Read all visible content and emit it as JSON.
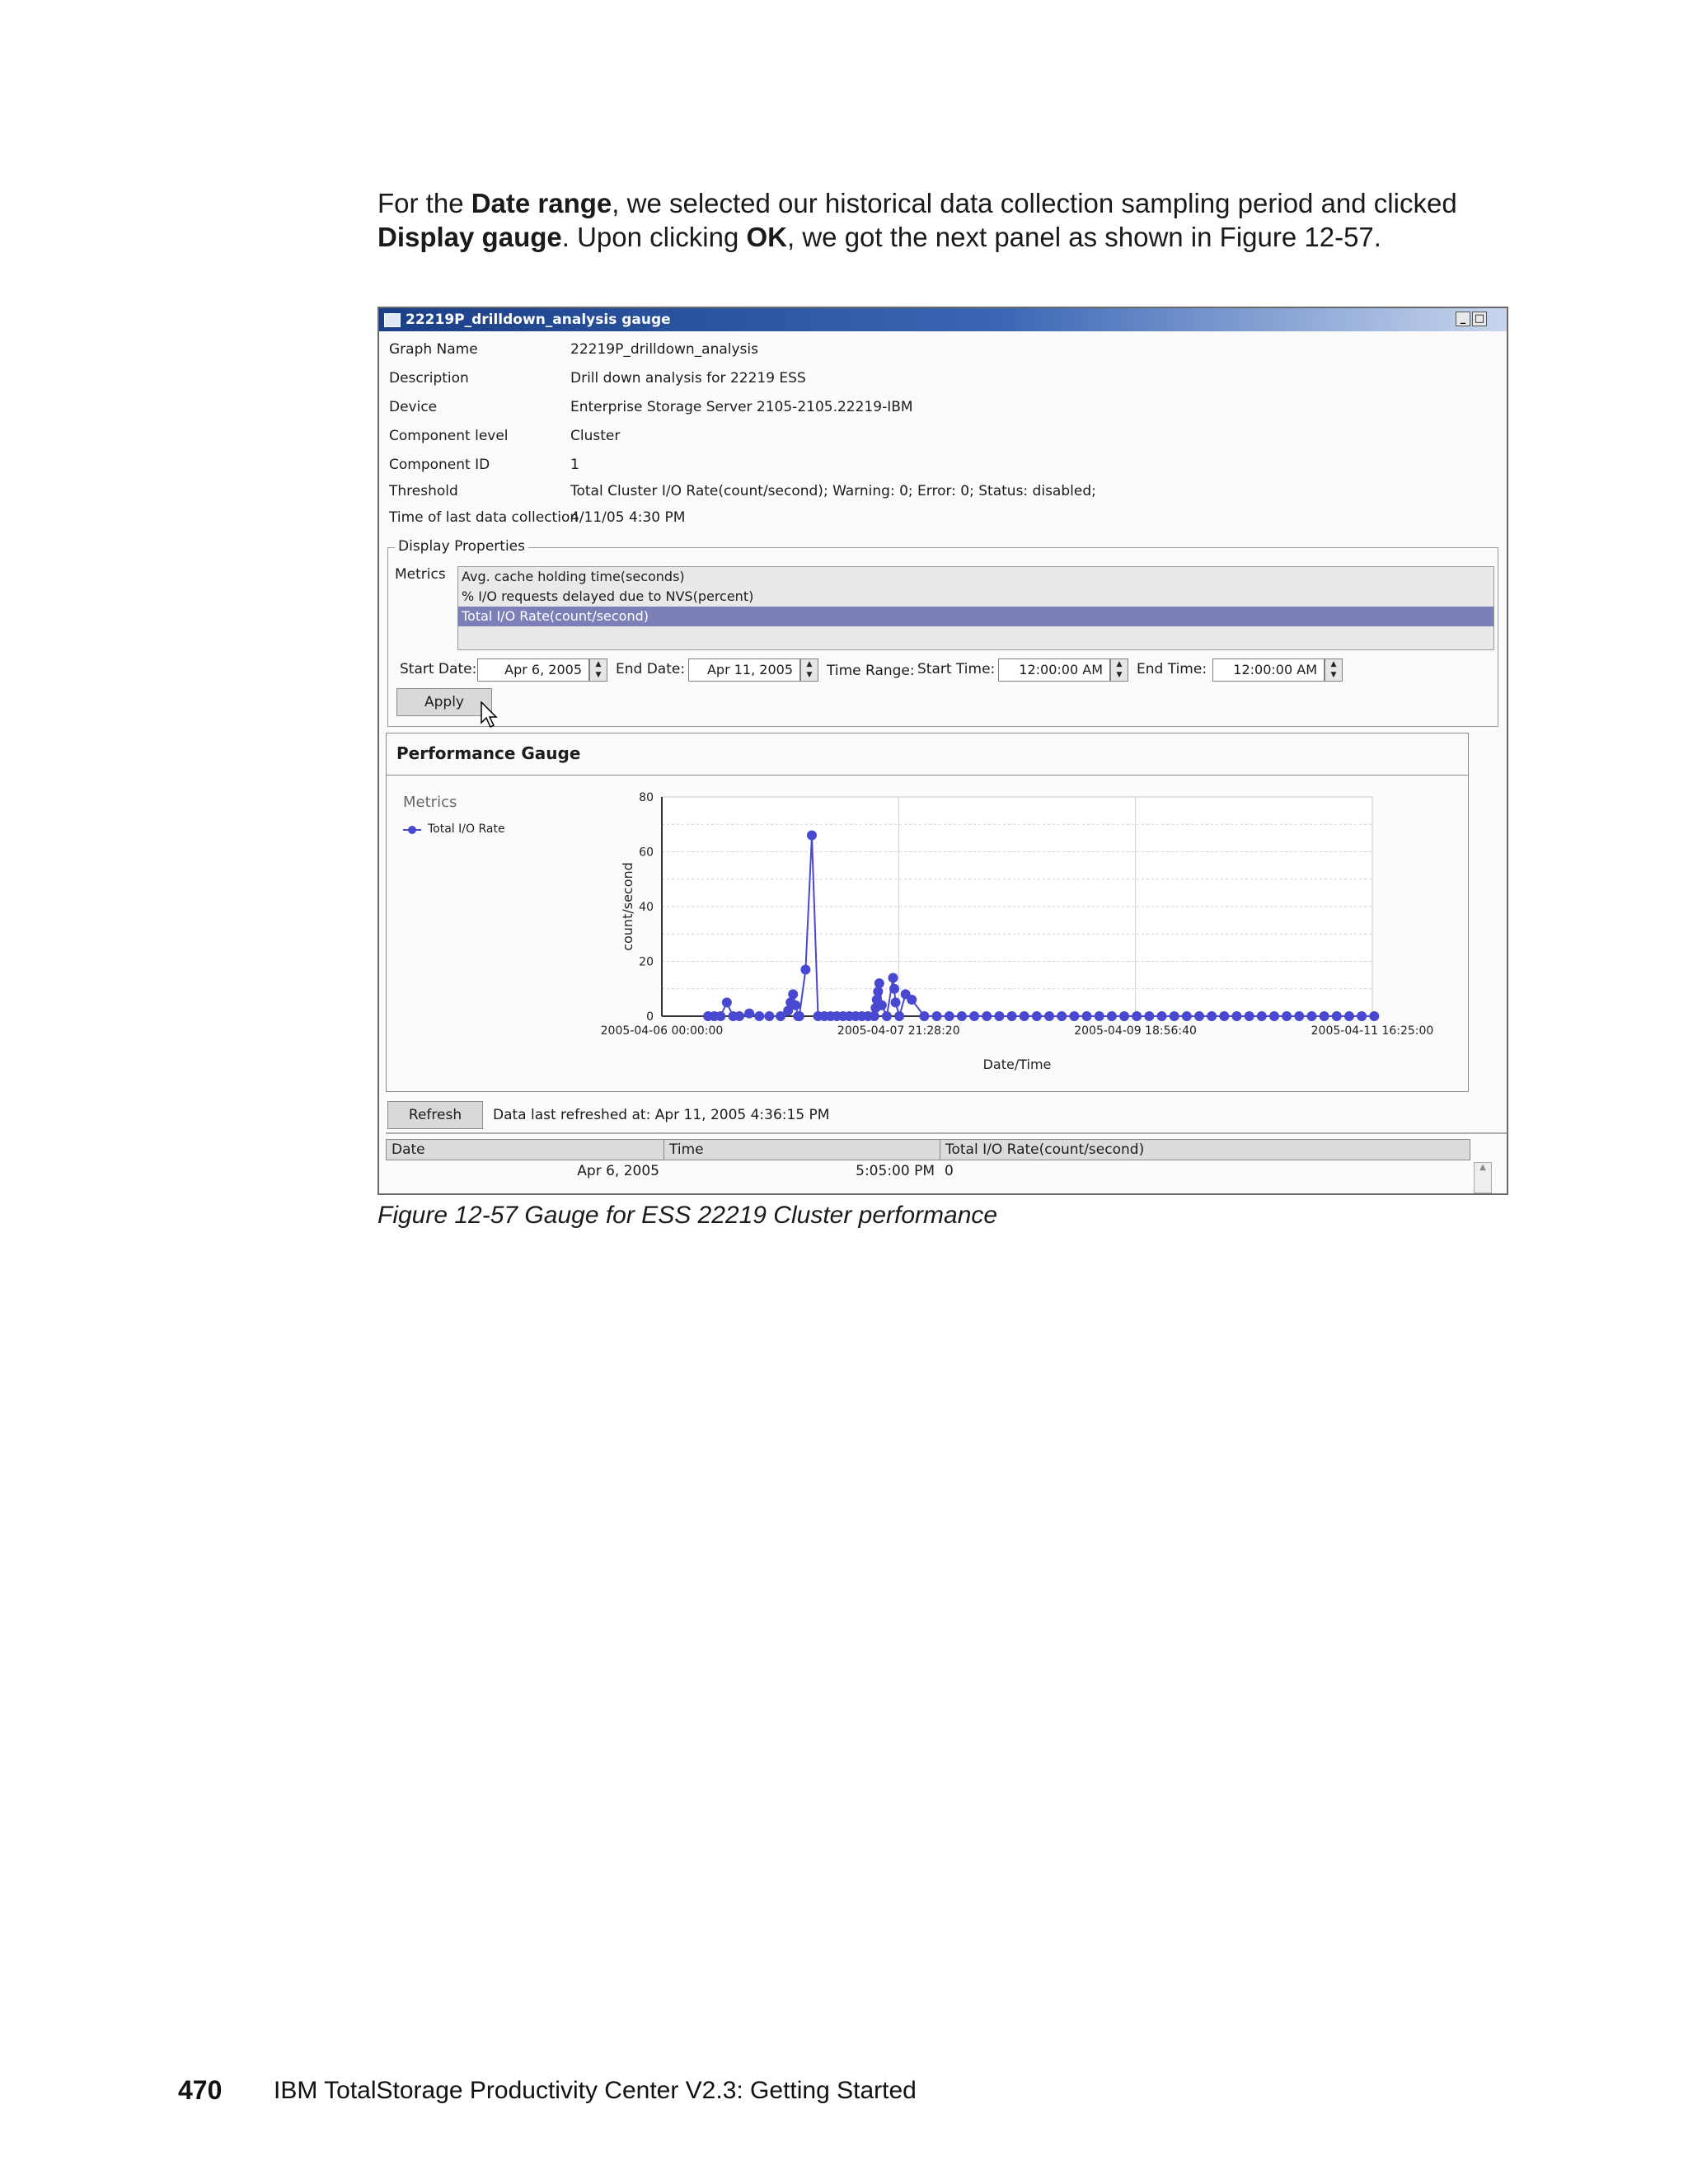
{
  "intro": {
    "p1": "For the ",
    "b1": "Date range",
    "p2": ", we selected our historical data collection sampling period and clicked ",
    "b2": "Display gauge",
    "p3": ". Upon clicking ",
    "b3": "OK",
    "p4": ", we got the next panel as shown in Figure 12-57."
  },
  "window": {
    "title": "22219P_drilldown_analysis gauge",
    "min_glyph": "_",
    "max_glyph": "□",
    "properties": [
      {
        "label": "Graph Name",
        "value": "22219P_drilldown_analysis"
      },
      {
        "label": "Description",
        "value": "Drill down analysis for 22219 ESS"
      },
      {
        "label": "Device",
        "value": "Enterprise Storage Server 2105-2105.22219-IBM"
      },
      {
        "label": "Component level",
        "value": "Cluster"
      },
      {
        "label": "Component ID",
        "value": "1"
      },
      {
        "label": "Threshold",
        "value": "Total Cluster I/O Rate(count/second); Warning: 0; Error: 0; Status: disabled;"
      },
      {
        "label": "Time of last data collection",
        "value": "4/11/05 4:30 PM"
      }
    ],
    "display_properties": {
      "legend": "Display Properties",
      "metrics_label": "Metrics",
      "metrics": [
        "Avg. cache holding time(seconds)",
        "% I/O requests delayed due to NVS(percent)",
        "Total I/O Rate(count/second)"
      ],
      "start_date_label": "Start Date:",
      "start_date": "Apr 6, 2005",
      "end_date_label": "End Date:",
      "end_date": "Apr 11, 2005",
      "time_range_label": "Time Range:",
      "start_time_label": "Start Time:",
      "start_time": "12:00:00 AM",
      "end_time_label": "End Time:",
      "end_time": "12:00:00 AM",
      "apply": "Apply"
    },
    "gauge": {
      "title": "Performance Gauge",
      "legend_title": "Metrics",
      "legend_item": "Total I/O Rate"
    },
    "refresh": "Refresh",
    "refreshed_text": "Data last refreshed at: Apr 11, 2005 4:36:15 PM",
    "table": {
      "headers": [
        "Date",
        "Time",
        "Total I/O Rate(count/second)"
      ],
      "rows": [
        {
          "date": "Apr 6, 2005",
          "time": "5:05:00 PM",
          "value": "0"
        }
      ]
    }
  },
  "chart_data": {
    "type": "line",
    "ylabel": "count/second",
    "xlabel": "Date/Time",
    "ylim": [
      0,
      80
    ],
    "y_ticks": [
      "0",
      "20",
      "40",
      "60",
      "80"
    ],
    "x_ticks": [
      "2005-04-06 00:00:00",
      "2005-04-07 21:28:20",
      "2005-04-09 18:56:40",
      "2005-04-11 16:25:00"
    ],
    "grid": true,
    "legend": "left",
    "series": [
      {
        "name": "Total I/O Rate",
        "color": "#4848d0",
        "x": [
          0.37,
          0.42,
          0.47,
          0.52,
          0.57,
          0.62,
          0.7,
          0.78,
          0.86,
          0.95,
          1.01,
          1.03,
          1.05,
          1.07,
          1.09,
          1.1,
          1.15,
          1.2,
          1.25,
          1.3,
          1.35,
          1.4,
          1.45,
          1.5,
          1.55,
          1.6,
          1.65,
          1.7,
          1.71,
          1.72,
          1.73,
          1.74,
          1.76,
          1.8,
          1.85,
          1.86,
          1.87,
          1.9,
          1.95,
          2.0,
          2.1,
          2.2,
          2.3,
          2.4,
          2.5,
          2.6,
          2.7,
          2.8,
          2.9,
          3.0,
          3.1,
          3.2,
          3.3,
          3.4,
          3.5,
          3.6,
          3.7,
          3.8,
          3.9,
          4.0,
          4.1,
          4.2,
          4.3,
          4.4,
          4.5,
          4.6,
          4.7,
          4.8,
          4.9,
          5.0,
          5.1,
          5.2,
          5.3,
          5.4,
          5.5,
          5.6,
          5.7
        ],
        "y": [
          0,
          0,
          0,
          5,
          0,
          0,
          1,
          0,
          0,
          0,
          2,
          5,
          8,
          4,
          0,
          0,
          17,
          66,
          0,
          0,
          0,
          0,
          0,
          0,
          0,
          0,
          0,
          0,
          3,
          6,
          9,
          12,
          4,
          0,
          14,
          10,
          5,
          0,
          8,
          6,
          0,
          0,
          0,
          0,
          0,
          0,
          0,
          0,
          0,
          0,
          0,
          0,
          0,
          0,
          0,
          0,
          0,
          0,
          0,
          0,
          0,
          0,
          0,
          0,
          0,
          0,
          0,
          0,
          0,
          0,
          0,
          0,
          0,
          0,
          0,
          0,
          0
        ],
        "x_unit": "days since 2005-04-06 00:00:00"
      }
    ]
  },
  "caption": "Figure 12-57   Gauge for ESS 22219 Cluster performance",
  "footer": {
    "page": "470",
    "title": "IBM TotalStorage Productivity Center V2.3: Getting Started"
  }
}
